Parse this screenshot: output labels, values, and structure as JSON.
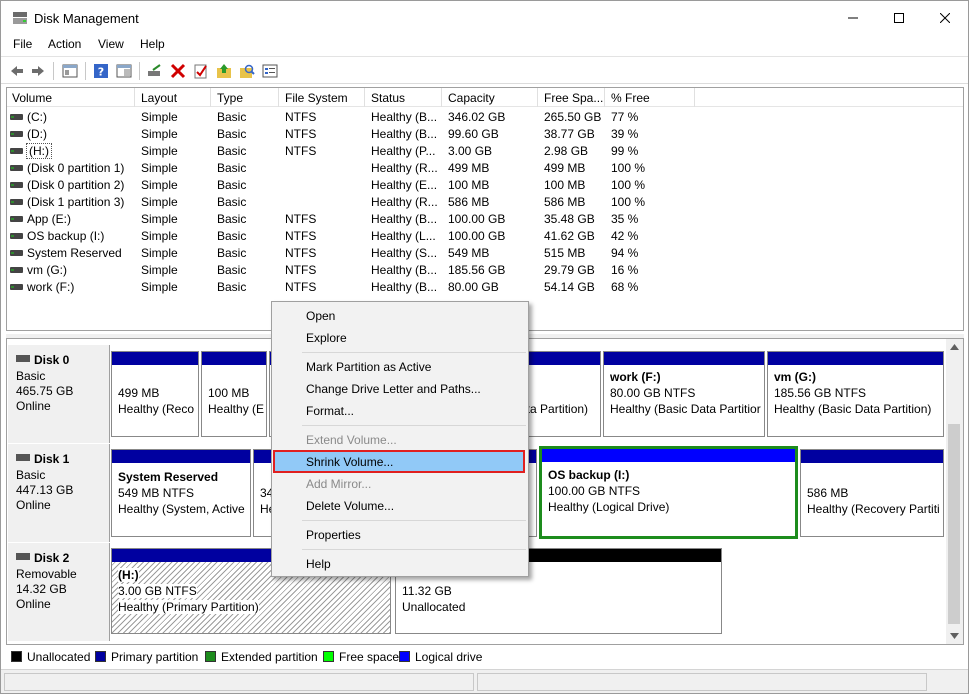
{
  "window": {
    "title": "Disk Management"
  },
  "menu": [
    "File",
    "Action",
    "View",
    "Help"
  ],
  "columns": [
    "Volume",
    "Layout",
    "Type",
    "File System",
    "Status",
    "Capacity",
    "Free Spa...",
    "% Free"
  ],
  "volumes": [
    [
      "(C:)",
      "Simple",
      "Basic",
      "NTFS",
      "Healthy (B...",
      "346.02 GB",
      "265.50 GB",
      "77 %"
    ],
    [
      "(D:)",
      "Simple",
      "Basic",
      "NTFS",
      "Healthy (B...",
      "99.60 GB",
      "38.77 GB",
      "39 %"
    ],
    [
      "(H:)",
      "Simple",
      "Basic",
      "NTFS",
      "Healthy (P...",
      "3.00 GB",
      "2.98 GB",
      "99 %"
    ],
    [
      "(Disk 0 partition 1)",
      "Simple",
      "Basic",
      "",
      "Healthy (R...",
      "499 MB",
      "499 MB",
      "100 %"
    ],
    [
      "(Disk 0 partition 2)",
      "Simple",
      "Basic",
      "",
      "Healthy (E...",
      "100 MB",
      "100 MB",
      "100 %"
    ],
    [
      "(Disk 1 partition 3)",
      "Simple",
      "Basic",
      "",
      "Healthy (R...",
      "586 MB",
      "586 MB",
      "100 %"
    ],
    [
      "App (E:)",
      "Simple",
      "Basic",
      "NTFS",
      "Healthy (B...",
      "100.00 GB",
      "35.48 GB",
      "35 %"
    ],
    [
      "OS backup (I:)",
      "Simple",
      "Basic",
      "NTFS",
      "Healthy (L...",
      "100.00 GB",
      "41.62 GB",
      "42 %"
    ],
    [
      "System Reserved",
      "Simple",
      "Basic",
      "NTFS",
      "Healthy (S...",
      "549 MB",
      "515 MB",
      "94 %"
    ],
    [
      "vm (G:)",
      "Simple",
      "Basic",
      "NTFS",
      "Healthy (B...",
      "185.56 GB",
      "29.79 GB",
      "16 %"
    ],
    [
      "work (F:)",
      "Simple",
      "Basic",
      "NTFS",
      "Healthy (B...",
      "80.00 GB",
      "54.14 GB",
      "68 %"
    ]
  ],
  "disks": [
    {
      "name": "Disk 0",
      "type": "Basic",
      "size": "465.75 GB",
      "state": "Online"
    },
    {
      "name": "Disk 1",
      "type": "Basic",
      "size": "447.13 GB",
      "state": "Online"
    },
    {
      "name": "Disk 2",
      "type": "Removable",
      "size": "14.32 GB",
      "state": "Online"
    }
  ],
  "partitions": {
    "d0p1": {
      "size": "499 MB",
      "status": "Healthy (Reco"
    },
    "d0p2": {
      "size": "100 MB",
      "status": "Healthy (E"
    },
    "d0mid": {
      "status": "ata Partition)"
    },
    "d0work": {
      "name": "work  (F:)",
      "size": "80.00 GB NTFS",
      "status": "Healthy (Basic Data Partitior"
    },
    "d0vm": {
      "name": "vm  (G:)",
      "size": "185.56 GB NTFS",
      "status": "Healthy (Basic Data Partition)"
    },
    "d1sys": {
      "name": "System Reserved",
      "size": "549 MB NTFS",
      "status": "Healthy (System, Active"
    },
    "d1p2": {
      "size": "34",
      "status": "He"
    },
    "d1os": {
      "name": "OS backup  (I:)",
      "size": "100.00 GB NTFS",
      "status": "Healthy (Logical Drive)"
    },
    "d1rec": {
      "size": "586 MB",
      "status": "Healthy (Recovery Partiti"
    },
    "d2h": {
      "name": "(H:)",
      "size": "3.00 GB NTFS",
      "status": "Healthy (Primary Partition)"
    },
    "d2un": {
      "size": "11.32 GB",
      "status": "Unallocated"
    }
  },
  "legend": [
    {
      "label": "Unallocated",
      "color": "#000000"
    },
    {
      "label": "Primary partition",
      "color": "#0000a0"
    },
    {
      "label": "Extended partition",
      "color": "#1d8c1d"
    },
    {
      "label": "Free space",
      "color": "#00ff00"
    },
    {
      "label": "Logical drive",
      "color": "#0000ff"
    }
  ],
  "context_menu": {
    "open": "Open",
    "explore": "Explore",
    "mark_active": "Mark Partition as Active",
    "change_letter": "Change Drive Letter and Paths...",
    "format": "Format...",
    "extend": "Extend Volume...",
    "shrink": "Shrink Volume...",
    "add_mirror": "Add Mirror...",
    "delete": "Delete Volume...",
    "properties": "Properties",
    "help": "Help"
  }
}
